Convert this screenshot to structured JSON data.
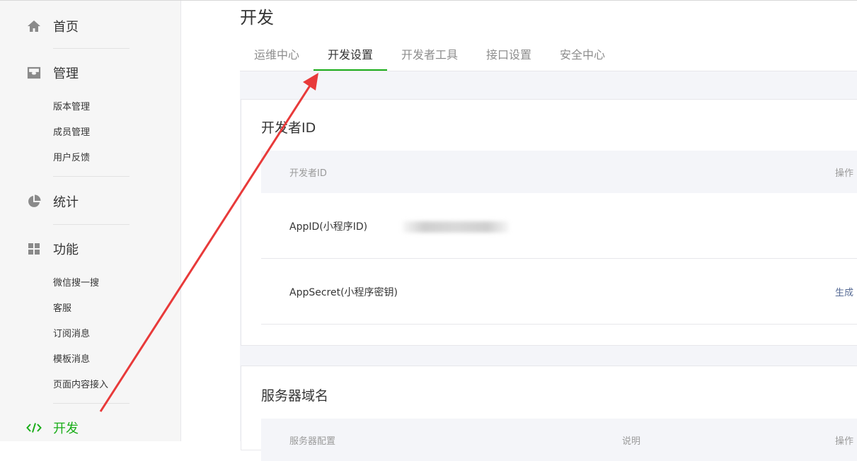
{
  "sidebar": {
    "home": {
      "label": "首页"
    },
    "manage": {
      "label": "管理",
      "items": [
        {
          "label": "版本管理"
        },
        {
          "label": "成员管理"
        },
        {
          "label": "用户反馈"
        }
      ]
    },
    "stats": {
      "label": "统计"
    },
    "features": {
      "label": "功能",
      "items": [
        {
          "label": "微信搜一搜"
        },
        {
          "label": "客服"
        },
        {
          "label": "订阅消息"
        },
        {
          "label": "模板消息"
        },
        {
          "label": "页面内容接入"
        }
      ]
    },
    "dev": {
      "label": "开发"
    }
  },
  "main": {
    "title": "开发",
    "tabs": [
      {
        "label": "运维中心",
        "active": false
      },
      {
        "label": "开发设置",
        "active": true
      },
      {
        "label": "开发者工具",
        "active": false
      },
      {
        "label": "接口设置",
        "active": false
      },
      {
        "label": "安全中心",
        "active": false
      }
    ],
    "dev_id_card": {
      "title": "开发者ID",
      "columns": {
        "name": "开发者ID",
        "action": "操作"
      },
      "rows": [
        {
          "label": "AppID(小程序ID)",
          "value_obscured": true,
          "action": ""
        },
        {
          "label": "AppSecret(小程序密钥)",
          "action": "生成"
        }
      ]
    },
    "server_card": {
      "title": "服务器域名",
      "columns": {
        "config": "服务器配置",
        "desc": "说明",
        "action": "操作"
      }
    }
  },
  "colors": {
    "accent_green": "#1aad19",
    "link_blue": "#576b95",
    "annotation_red": "#e83a3a"
  }
}
